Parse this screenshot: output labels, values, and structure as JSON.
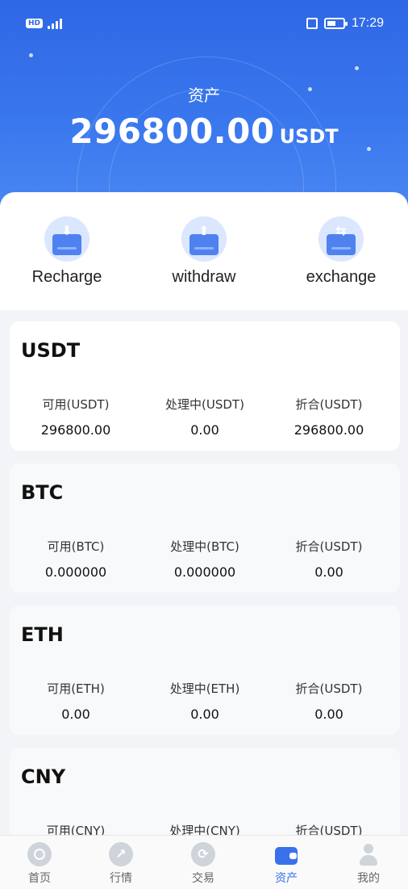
{
  "status_bar": {
    "time": "17:29",
    "hd": "HD"
  },
  "header": {
    "title": "资产",
    "total_amount": "296800.00",
    "total_unit": "USDT"
  },
  "actions": [
    {
      "label": "Recharge",
      "icon": "download-card-icon"
    },
    {
      "label": "withdraw",
      "icon": "upload-card-icon"
    },
    {
      "label": "exchange",
      "icon": "swap-card-icon"
    }
  ],
  "assets": [
    {
      "name": "USDT",
      "cols": [
        {
          "label": "可用(USDT)",
          "value": "296800.00"
        },
        {
          "label": "处理中(USDT)",
          "value": "0.00"
        },
        {
          "label": "折合(USDT)",
          "value": "296800.00"
        }
      ]
    },
    {
      "name": "BTC",
      "cols": [
        {
          "label": "可用(BTC)",
          "value": "0.000000"
        },
        {
          "label": "处理中(BTC)",
          "value": "0.000000"
        },
        {
          "label": "折合(USDT)",
          "value": "0.00"
        }
      ]
    },
    {
      "name": "ETH",
      "cols": [
        {
          "label": "可用(ETH)",
          "value": "0.00"
        },
        {
          "label": "处理中(ETH)",
          "value": "0.00"
        },
        {
          "label": "折合(USDT)",
          "value": "0.00"
        }
      ]
    },
    {
      "name": "CNY",
      "cols": [
        {
          "label": "可用(CNY)",
          "value": ""
        },
        {
          "label": "处理中(CNY)",
          "value": ""
        },
        {
          "label": "折合(USDT)",
          "value": ""
        }
      ]
    }
  ],
  "tabbar": [
    {
      "label": "首页",
      "icon": "home-icon"
    },
    {
      "label": "行情",
      "icon": "market-icon"
    },
    {
      "label": "交易",
      "icon": "trade-icon"
    },
    {
      "label": "资产",
      "icon": "wallet-icon",
      "active": true
    },
    {
      "label": "我的",
      "icon": "user-icon"
    }
  ],
  "colors": {
    "header": "#2f67e5",
    "accent": "#3a71ea"
  }
}
